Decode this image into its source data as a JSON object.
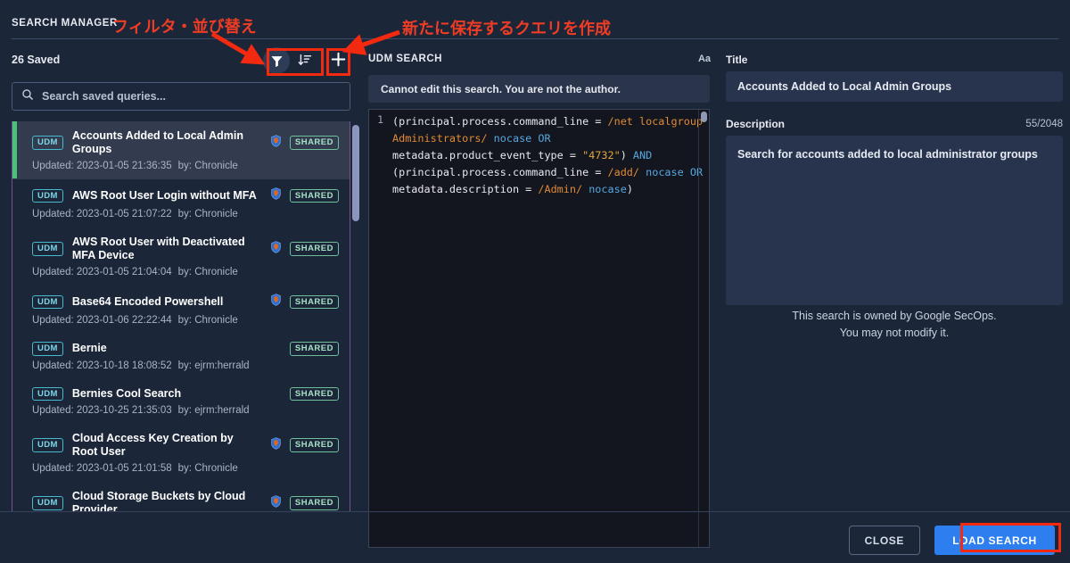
{
  "dialog": {
    "title": "SEARCH MANAGER",
    "close_label": "CLOSE",
    "load_label": "LOAD SEARCH"
  },
  "left_panel": {
    "saved_count_label": "26 Saved",
    "toolbar": {
      "filter_icon": "filter-icon",
      "sort_icon": "sort-descending-icon",
      "add_icon": "plus-icon"
    },
    "search": {
      "placeholder": "Search saved queries...",
      "value": "",
      "icon": "search-icon"
    },
    "items": [
      {
        "type": "UDM",
        "name": "Accounts Added to Local Admin Groups",
        "shield": true,
        "shared": "SHARED",
        "updated": "Updated: 2023-01-05 21:36:35",
        "by": "by: Chronicle",
        "selected": true
      },
      {
        "type": "UDM",
        "name": "AWS Root User Login without MFA",
        "shield": true,
        "shared": "SHARED",
        "updated": "Updated: 2023-01-05 21:07:22",
        "by": "by: Chronicle",
        "selected": false
      },
      {
        "type": "UDM",
        "name": "AWS Root User with Deactivated MFA Device",
        "shield": true,
        "shared": "SHARED",
        "updated": "Updated: 2023-01-05 21:04:04",
        "by": "by: Chronicle",
        "selected": false
      },
      {
        "type": "UDM",
        "name": "Base64 Encoded Powershell",
        "shield": true,
        "shared": "SHARED",
        "updated": "Updated: 2023-01-06 22:22:44",
        "by": "by: Chronicle",
        "selected": false
      },
      {
        "type": "UDM",
        "name": "Bernie",
        "shield": false,
        "shared": "SHARED",
        "updated": "Updated: 2023-10-18 18:08:52",
        "by": "by: ejrm:herrald",
        "selected": false
      },
      {
        "type": "UDM",
        "name": "Bernies Cool Search",
        "shield": false,
        "shared": "SHARED",
        "updated": "Updated: 2023-10-25 21:35:03",
        "by": "by: ejrm:herrald",
        "selected": false
      },
      {
        "type": "UDM",
        "name": "Cloud Access Key Creation by Root User",
        "shield": true,
        "shared": "SHARED",
        "updated": "Updated: 2023-01-05 21:01:58",
        "by": "by: Chronicle",
        "selected": false
      },
      {
        "type": "UDM",
        "name": "Cloud Storage Buckets by Cloud Provider",
        "shield": true,
        "shared": "SHARED",
        "updated": "",
        "by": "",
        "selected": false
      }
    ]
  },
  "middle_panel": {
    "title": "UDM SEARCH",
    "font_size_icon": "Aa",
    "notice": "Cannot edit this search. You are not the author.",
    "line_number": "1",
    "query_tokens": [
      {
        "t": "(principal.process.command_line = ",
        "c": "plain"
      },
      {
        "t": "/net localgroup Administrators/",
        "c": "re"
      },
      {
        "t": " ",
        "c": "plain"
      },
      {
        "t": "nocase",
        "c": "kw"
      },
      {
        "t": " ",
        "c": "plain"
      },
      {
        "t": "OR",
        "c": "kw"
      },
      {
        "t": " metadata.product_event_type = ",
        "c": "plain"
      },
      {
        "t": "\"4732\"",
        "c": "str"
      },
      {
        "t": ") ",
        "c": "plain"
      },
      {
        "t": "AND",
        "c": "kw"
      },
      {
        "t": " (principal.process.command_line = ",
        "c": "plain"
      },
      {
        "t": "/add/",
        "c": "re"
      },
      {
        "t": " ",
        "c": "plain"
      },
      {
        "t": "nocase",
        "c": "kw"
      },
      {
        "t": " ",
        "c": "plain"
      },
      {
        "t": "OR",
        "c": "kw"
      },
      {
        "t": " metadata.description = ",
        "c": "plain"
      },
      {
        "t": "/Admin/",
        "c": "re"
      },
      {
        "t": " ",
        "c": "plain"
      },
      {
        "t": "nocase",
        "c": "kw"
      },
      {
        "t": ")",
        "c": "plain"
      }
    ]
  },
  "right_panel": {
    "title_label": "Title",
    "title_value": "Accounts Added to Local Admin Groups",
    "description_label": "Description",
    "description_count": "55/2048",
    "description_value": "Search for accounts added to local administrator groups",
    "owner_note_line1": "This search is owned by Google SecOps.",
    "owner_note_line2": "You may not modify it."
  },
  "annotations": {
    "filter_sort": "フィルタ・並び替え",
    "create_query": "新たに保存するクエリを作成"
  },
  "colors": {
    "accent_blue": "#2d7ff0",
    "annotation_red": "#f42a10",
    "selected_bar_green": "#49c178",
    "chip_cyan": "#49b9cf",
    "chip_green": "#6fbf9a"
  }
}
